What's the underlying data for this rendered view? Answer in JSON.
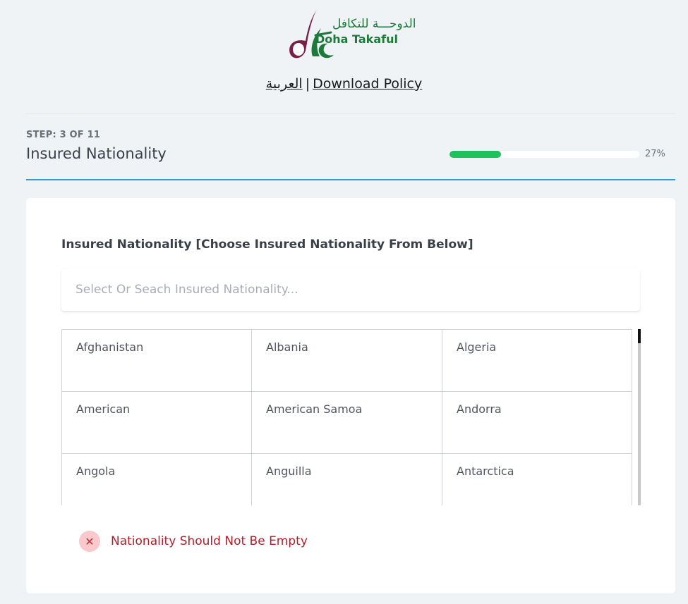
{
  "brand": {
    "name_ar": "الدوحـــة للتكافل",
    "name_en": "Doha Takaful",
    "color_green": "#1e7a3a",
    "color_maroon": "#7a1f45"
  },
  "links": {
    "arabic": "العربية",
    "separator": "|",
    "download_policy": "Download Policy"
  },
  "step": {
    "label": "STEP: 3 OF 11",
    "title": "Insured Nationality",
    "progress": 27,
    "progress_text": "27%",
    "progress_color": "#1ec25a"
  },
  "form": {
    "label": "Insured Nationality [Choose Insured Nationality From Below]",
    "placeholder": "Select Or Seach Insured Nationality...",
    "options": [
      "Afghanistan",
      "Albania",
      "Algeria",
      "American",
      "American Samoa",
      "Andorra",
      "Angola",
      "Anguilla",
      "Antarctica"
    ]
  },
  "error": {
    "icon": "close-icon",
    "message": "Nationality Should Not Be Empty",
    "color": "#b01e2a"
  }
}
